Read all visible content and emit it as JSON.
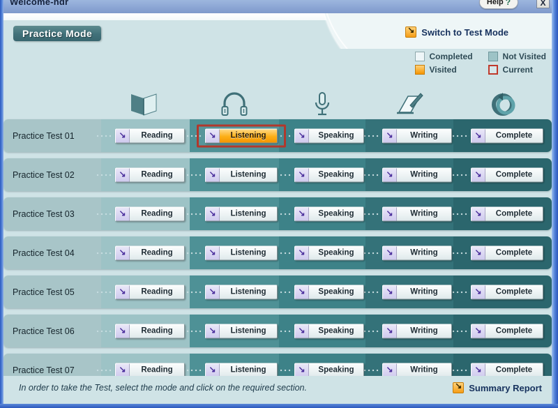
{
  "window": {
    "title": "Welcome-hdr",
    "help_label": "Help",
    "help_mark": "?",
    "close_label": "X"
  },
  "header": {
    "mode_tab": "Practice Mode",
    "switch_link": "Switch to Test Mode",
    "switch_icon": "external-arrow-icon"
  },
  "legend": [
    {
      "key": "completed",
      "label": "Completed",
      "color": "#eef6f8"
    },
    {
      "key": "not_visited",
      "label": "Not Visited",
      "color": "#9dc3c6"
    },
    {
      "key": "visited",
      "label": "Visited",
      "color": "#f59500"
    },
    {
      "key": "current",
      "label": "Current",
      "color": "#c0392b"
    }
  ],
  "columns": [
    {
      "key": "reading",
      "label": "Reading",
      "icon": "open-book-icon"
    },
    {
      "key": "listening",
      "label": "Listening",
      "icon": "headphones-icon"
    },
    {
      "key": "speaking",
      "label": "Speaking",
      "icon": "microphone-icon"
    },
    {
      "key": "writing",
      "label": "Writing",
      "icon": "pen-writing-icon"
    },
    {
      "key": "complete",
      "label": "Complete",
      "icon": "circular-arrow-icon"
    }
  ],
  "rows": [
    {
      "label": "Practice Test 01",
      "cells": [
        {
          "label": "Reading",
          "state": "completed",
          "current": false
        },
        {
          "label": "Listening",
          "state": "visited",
          "current": true
        },
        {
          "label": "Speaking",
          "state": "completed",
          "current": false
        },
        {
          "label": "Writing",
          "state": "completed",
          "current": false
        },
        {
          "label": "Complete",
          "state": "completed",
          "current": false
        }
      ]
    },
    {
      "label": "Practice Test 02",
      "cells": [
        {
          "label": "Reading",
          "state": "completed",
          "current": false
        },
        {
          "label": "Listening",
          "state": "completed",
          "current": false
        },
        {
          "label": "Speaking",
          "state": "completed",
          "current": false
        },
        {
          "label": "Writing",
          "state": "completed",
          "current": false
        },
        {
          "label": "Complete",
          "state": "completed",
          "current": false
        }
      ]
    },
    {
      "label": "Practice Test 03",
      "cells": [
        {
          "label": "Reading",
          "state": "completed",
          "current": false
        },
        {
          "label": "Listening",
          "state": "completed",
          "current": false
        },
        {
          "label": "Speaking",
          "state": "completed",
          "current": false
        },
        {
          "label": "Writing",
          "state": "completed",
          "current": false
        },
        {
          "label": "Complete",
          "state": "completed",
          "current": false
        }
      ]
    },
    {
      "label": "Practice Test 04",
      "cells": [
        {
          "label": "Reading",
          "state": "completed",
          "current": false
        },
        {
          "label": "Listening",
          "state": "completed",
          "current": false
        },
        {
          "label": "Speaking",
          "state": "completed",
          "current": false
        },
        {
          "label": "Writing",
          "state": "completed",
          "current": false
        },
        {
          "label": "Complete",
          "state": "completed",
          "current": false
        }
      ]
    },
    {
      "label": "Practice Test 05",
      "cells": [
        {
          "label": "Reading",
          "state": "completed",
          "current": false
        },
        {
          "label": "Listening",
          "state": "completed",
          "current": false
        },
        {
          "label": "Speaking",
          "state": "completed",
          "current": false
        },
        {
          "label": "Writing",
          "state": "completed",
          "current": false
        },
        {
          "label": "Complete",
          "state": "completed",
          "current": false
        }
      ]
    },
    {
      "label": "Practice Test 06",
      "cells": [
        {
          "label": "Reading",
          "state": "completed",
          "current": false
        },
        {
          "label": "Listening",
          "state": "completed",
          "current": false
        },
        {
          "label": "Speaking",
          "state": "completed",
          "current": false
        },
        {
          "label": "Writing",
          "state": "completed",
          "current": false
        },
        {
          "label": "Complete",
          "state": "completed",
          "current": false
        }
      ]
    },
    {
      "label": "Practice Test 07",
      "cells": [
        {
          "label": "Reading",
          "state": "completed",
          "current": false
        },
        {
          "label": "Listening",
          "state": "completed",
          "current": false
        },
        {
          "label": "Speaking",
          "state": "completed",
          "current": false
        },
        {
          "label": "Writing",
          "state": "completed",
          "current": false
        },
        {
          "label": "Complete",
          "state": "completed",
          "current": false
        }
      ]
    }
  ],
  "footer": {
    "hint": "In order to take the Test, select the mode and click on the required section.",
    "summary_link": "Summary Report",
    "summary_icon": "external-arrow-icon"
  }
}
